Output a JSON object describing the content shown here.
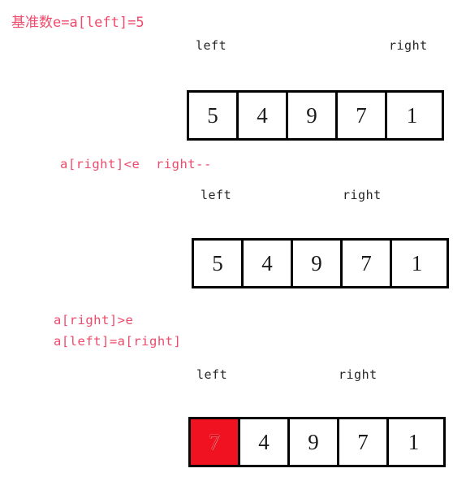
{
  "title": {
    "text": "基准数e=a[left]=5",
    "color": "#ef4a6b"
  },
  "colors": {
    "annotation": "#ef4a6b",
    "highlight_cell": "#f01221",
    "box_border": "#000000",
    "pointer_label": "#262626"
  },
  "steps": [
    {
      "annotation": "",
      "pointers": {
        "left": "left",
        "right": "right"
      },
      "array": {
        "values": [
          "5",
          "4",
          "9",
          "7",
          "1"
        ],
        "highlight_index": -1
      }
    },
    {
      "annotation": "a[right]<e  right--",
      "pointers": {
        "left": "left",
        "right": "right"
      },
      "array": {
        "values": [
          "5",
          "4",
          "9",
          "7",
          "1"
        ],
        "highlight_index": -1
      }
    },
    {
      "annotation_line1": "a[right]>e",
      "annotation_line2": "a[left]=a[right]",
      "pointers": {
        "left": "left",
        "right": "right"
      },
      "array": {
        "values": [
          "7",
          "4",
          "9",
          "7",
          "1"
        ],
        "highlight_index": 0
      }
    }
  ]
}
